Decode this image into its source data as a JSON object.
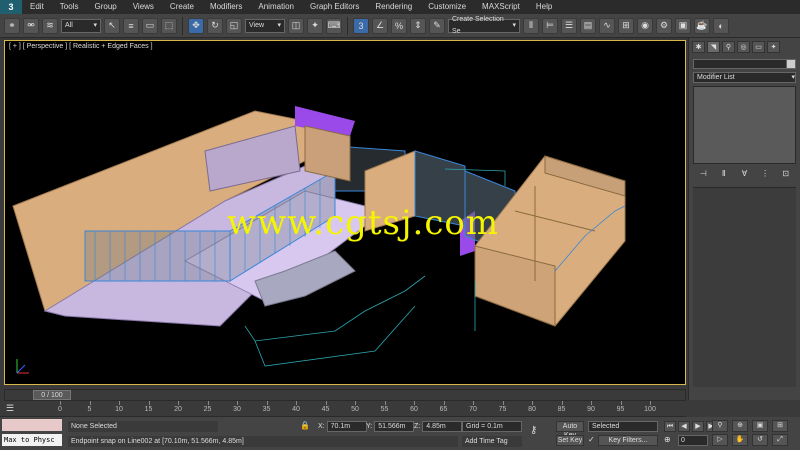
{
  "app": {
    "logo_label": "3"
  },
  "menu": {
    "items": [
      "Edit",
      "Tools",
      "Group",
      "Views",
      "Create",
      "Modifiers",
      "Animation",
      "Graph Editors",
      "Rendering",
      "Customize",
      "MAXScript",
      "Help"
    ]
  },
  "toolbar": {
    "selection_filter": "All",
    "reference_coord": "View",
    "named_selection": "Create Selection Se"
  },
  "viewport": {
    "label": "[ + ] [ Perspective ] [ Realistic + Edged Faces ]",
    "watermark": "www.cgtsj.com"
  },
  "command_panel": {
    "modifier_list": "Modifier List",
    "stack_controls": [
      "⊣",
      "Ⅱ",
      "∀",
      "⋮",
      "⊡"
    ]
  },
  "timeline": {
    "slider_text": "0 / 100",
    "ticks": [
      0,
      5,
      10,
      15,
      20,
      25,
      30,
      35,
      40,
      45,
      50,
      55,
      60,
      65,
      70,
      75,
      80,
      85,
      90,
      95,
      100
    ]
  },
  "status": {
    "maxscript_output": "Max to Physc",
    "selection": "None Selected",
    "prompt": "Endpoint snap on Line002 at [70.10m, 51.566m, 4.85m]",
    "x_label": "X:",
    "x_value": "70.1m",
    "y_label": "Y:",
    "y_value": "51.566m",
    "z_label": "Z:",
    "z_value": "4.85m",
    "grid": "Grid = 0.1m",
    "add_time_tag": "Add Time Tag",
    "auto_key": "Auto Key",
    "set_key": "Set Key",
    "selected": "Selected",
    "key_filters": "Key Filters...",
    "frame": "0"
  }
}
